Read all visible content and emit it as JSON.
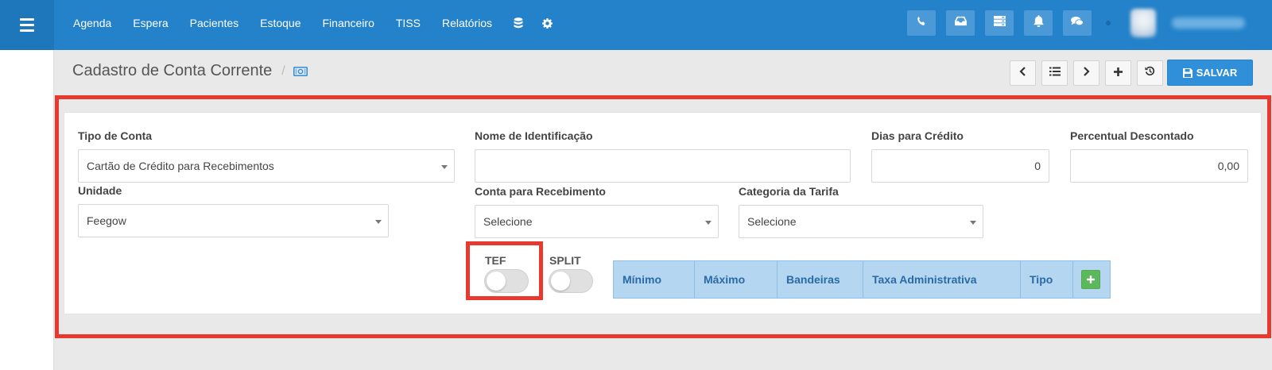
{
  "nav": {
    "items": [
      "Agenda",
      "Espera",
      "Pacientes",
      "Estoque",
      "Financeiro",
      "TISS",
      "Relatórios"
    ],
    "icons": [
      "database-icon",
      "gear-icon"
    ]
  },
  "topbar": {
    "buttons": [
      "phone-icon",
      "inbox-icon",
      "server-icon",
      "bell-icon",
      "chat-icon"
    ],
    "color": "#2382c9"
  },
  "page": {
    "title": "Cadastro de Conta Corrente",
    "breadcrumb_sep": "/",
    "save_label": "SALVAR"
  },
  "form": {
    "tipo_conta": {
      "label": "Tipo de Conta",
      "value": "Cartão de Crédito para Recebimentos"
    },
    "nome": {
      "label": "Nome de Identificação",
      "value": ""
    },
    "dias": {
      "label": "Dias para Crédito",
      "value": "0"
    },
    "percentual": {
      "label": "Percentual Descontado",
      "value": "0,00"
    },
    "unidade": {
      "label": "Unidade",
      "value": "Feegow"
    },
    "conta_receb": {
      "label": "Conta para Recebimento",
      "value": "Selecione"
    },
    "categoria": {
      "label": "Categoria da Tarifa",
      "value": "Selecione"
    },
    "tef": {
      "label": "TEF",
      "on": false
    },
    "split": {
      "label": "SPLIT",
      "on": false
    }
  },
  "tax_table": {
    "columns": [
      "Mínimo",
      "Máximo",
      "Bandeiras",
      "Taxa Administrativa",
      "Tipo"
    ]
  },
  "colors": {
    "accent": "#2f8fd8",
    "highlight": "#e8392f",
    "table_header": "#b4d6f1",
    "add_button": "#5cb85c"
  }
}
